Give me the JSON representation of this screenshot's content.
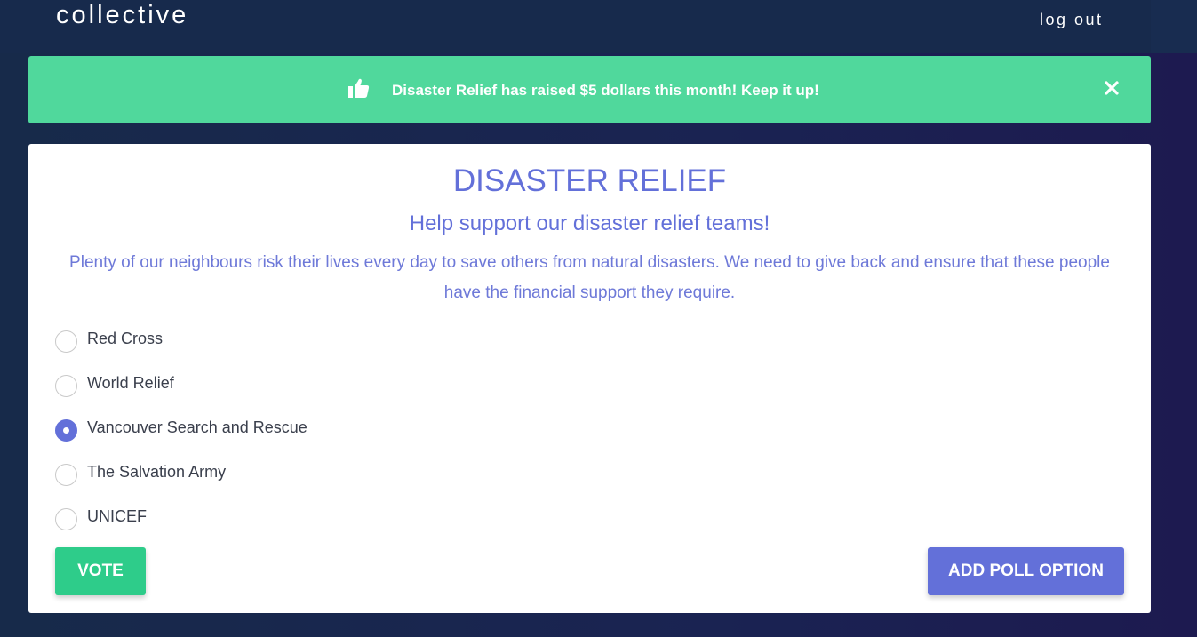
{
  "navbar": {
    "brand": "collective",
    "logout_label": "log out"
  },
  "alert": {
    "icon": "thumbs-up-icon",
    "message": "Disaster Relief has raised $5 dollars this month! Keep it up!",
    "close_icon": "close-icon",
    "color": "#50d89c"
  },
  "poll": {
    "title": "DISASTER RELIEF",
    "subtitle": "Help support our disaster relief teams!",
    "description": "Plenty of our neighbours risk their lives every day to save others from natural disasters. We need to give back and ensure that these people have the financial support they require.",
    "options": [
      {
        "label": "Red Cross",
        "selected": false
      },
      {
        "label": "World Relief",
        "selected": false
      },
      {
        "label": "Vancouver Search and Rescue",
        "selected": true
      },
      {
        "label": "The Salvation Army",
        "selected": false
      },
      {
        "label": "UNICEF",
        "selected": false
      }
    ],
    "vote_label": "VOTE",
    "add_option_label": "ADD POLL OPTION",
    "accent_color": "#6370d9",
    "vote_color": "#2ecc8a"
  }
}
